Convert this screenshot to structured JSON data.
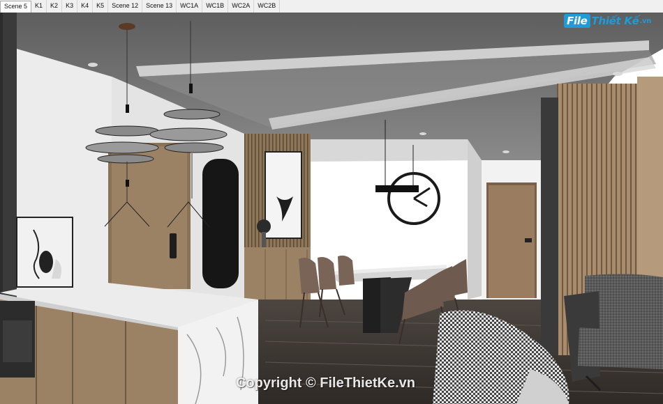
{
  "scene_tabs": {
    "items": [
      "Scene 5",
      "K1",
      "K2",
      "K3",
      "K4",
      "K5",
      "Scene 12",
      "Scene 13",
      "WC1A",
      "WC1B",
      "WC2A",
      "WC2B"
    ],
    "active": "Scene 5"
  },
  "watermark": {
    "logo_file": "File",
    "logo_name": "Thiết Kế",
    "logo_tld": ".vn",
    "copyright": "Copyright © FileThietKe.vn"
  },
  "colors": {
    "tab_bar": "#f0f0f0",
    "ceiling": "#707070",
    "wood": "#9c8264",
    "marble": "#f2f2f2",
    "wall": "#e6e6e6",
    "logo_blue": "#1f9bd8"
  }
}
